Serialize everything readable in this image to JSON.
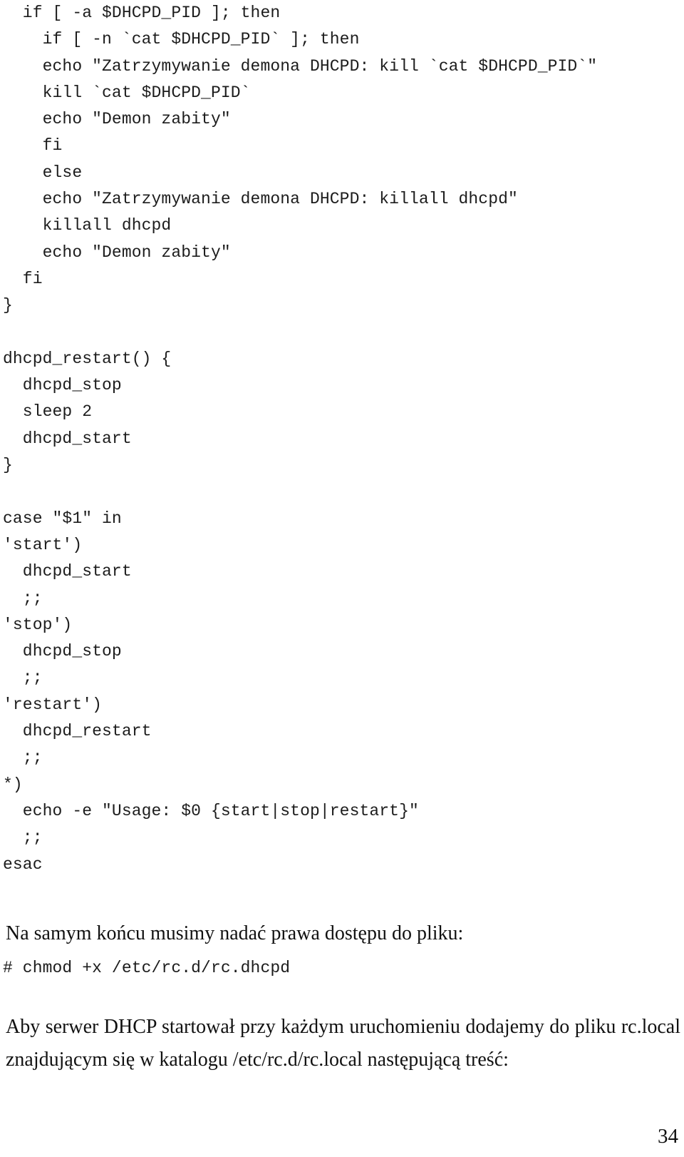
{
  "document": {
    "page_number": "34",
    "code_listing": [
      "  if [ -a $DHCPD_PID ]; then",
      "    if [ -n `cat $DHCPD_PID` ]; then",
      "    echo \"Zatrzymywanie demona DHCPD: kill `cat $DHCPD_PID`\"",
      "    kill `cat $DHCPD_PID`",
      "    echo \"Demon zabity\"",
      "    fi",
      "    else",
      "    echo \"Zatrzymywanie demona DHCPD: killall dhcpd\"",
      "    killall dhcpd",
      "    echo \"Demon zabity\"",
      "  fi",
      "}",
      "",
      "dhcpd_restart() {",
      "  dhcpd_stop",
      "  sleep 2",
      "  dhcpd_start",
      "}",
      "",
      "case \"$1\" in",
      "'start')",
      "  dhcpd_start",
      "  ;;",
      "'stop')",
      "  dhcpd_stop",
      "  ;;",
      "'restart')",
      "  dhcpd_restart",
      "  ;;",
      "*)",
      "  echo -e \"Usage: $0 {start|stop|restart}\"",
      "  ;;",
      "esac"
    ],
    "paragraph_permissions": "Na samym końcu musimy nadać prawa dostępu do pliku:",
    "shell_command": "# chmod +x /etc/rc.d/rc.dhcpd",
    "paragraph_autostart_line1": "Aby serwer DHCP startował przy każdym uruchomieniu dodajemy do pliku rc.local",
    "paragraph_autostart_line2": "znajdującym się w katalogu /etc/rc.d/rc.local następującą treść:"
  }
}
